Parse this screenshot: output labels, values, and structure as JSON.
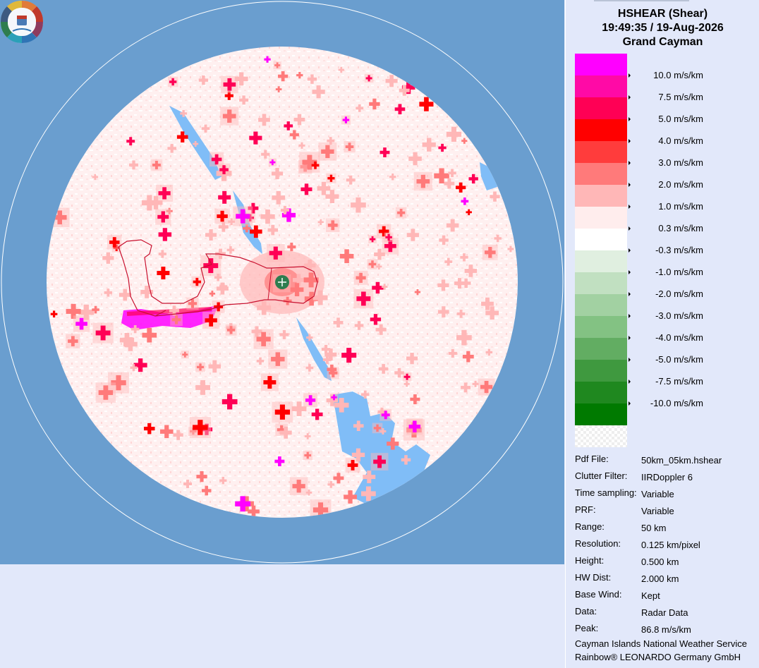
{
  "header": {
    "product": "HSHEAR (Shear)",
    "datetime": "19:49:35 / 19-Aug-2026",
    "site": "Grand Cayman"
  },
  "colors": {
    "ocean": "#6a9ecf",
    "land": "#80bdf7",
    "panel_bg": "#e2e8fa",
    "site_marker": "#2e7d4f"
  },
  "legend": [
    {
      "label": "10.0 m/s/km",
      "color": "#ff00ff"
    },
    {
      "label": "7.5 m/s/km",
      "color": "#ff0aa6"
    },
    {
      "label": "5.0 m/s/km",
      "color": "#ff0055"
    },
    {
      "label": "4.0 m/s/km",
      "color": "#ff0000"
    },
    {
      "label": "3.0 m/s/km",
      "color": "#ff3c3c"
    },
    {
      "label": "2.0 m/s/km",
      "color": "#ff7a7a"
    },
    {
      "label": "1.0 m/s/km",
      "color": "#ffb7b7"
    },
    {
      "label": "0.3 m/s/km",
      "color": "#ffeded"
    },
    {
      "label": "-0.3 m/s/km",
      "color": "#ffffff"
    },
    {
      "label": "-1.0 m/s/km",
      "color": "#e0efe0"
    },
    {
      "label": "-2.0 m/s/km",
      "color": "#c1e0c1"
    },
    {
      "label": "-3.0 m/s/km",
      "color": "#a2d1a2"
    },
    {
      "label": "-4.0 m/s/km",
      "color": "#83c283"
    },
    {
      "label": "-5.0 m/s/km",
      "color": "#62ad62"
    },
    {
      "label": "-7.5 m/s/km",
      "color": "#3f993f"
    },
    {
      "label": "-10.0 m/s/km",
      "color": "#1f881f"
    },
    {
      "label": "",
      "color": "#007a00"
    }
  ],
  "info": [
    {
      "key": "Pdf File:",
      "value": "50km_05km.hshear"
    },
    {
      "key": "Clutter Filter:",
      "value": "IIRDoppler 6"
    },
    {
      "key": "Time sampling:",
      "value": "Variable"
    },
    {
      "key": "PRF:",
      "value": "Variable"
    },
    {
      "key": "Range:",
      "value": "50 km"
    },
    {
      "key": "Resolution:",
      "value": "0.125 km/pixel"
    },
    {
      "key": "Height:",
      "value": "0.500 km"
    },
    {
      "key": "HW Dist:",
      "value": "2.000 km"
    },
    {
      "key": "Base Wind:",
      "value": "Kept"
    },
    {
      "key": "Data:",
      "value": "Radar Data"
    },
    {
      "key": "Peak:",
      "value": "86.8 m/s/km"
    }
  ],
  "footer": {
    "line1": "Cayman Islands National Weather Service",
    "line2": "Rainbow® LEONARDO Germany GmbH"
  },
  "icons": {
    "site_marker": "crosshair-plus-icon",
    "logo": "cayman-weather-service-logo"
  }
}
